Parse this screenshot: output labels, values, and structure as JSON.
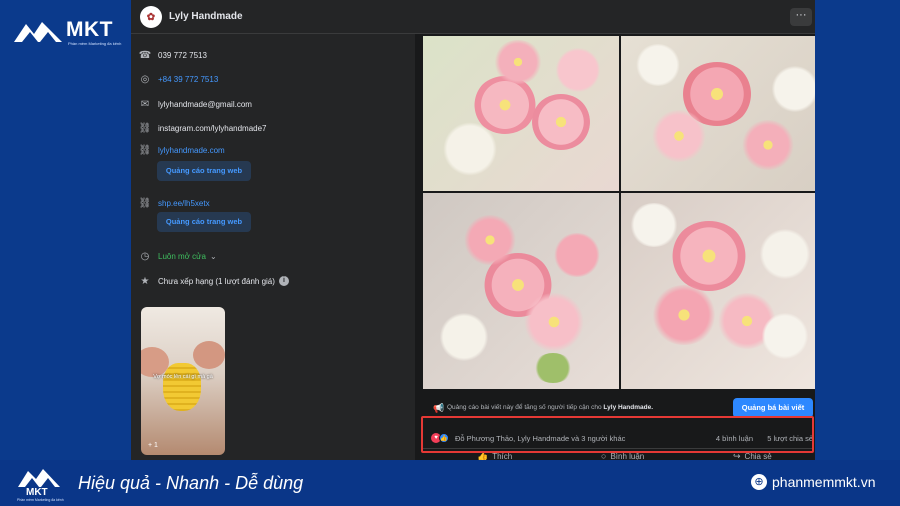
{
  "branding": {
    "logo_text": "MKT",
    "logo_tagline": "Phần mềm Marketing đa kênh",
    "slogan": "Hiệu quả - Nhanh  - Dễ dùng",
    "website": "phanmemmkt.vn",
    "bg_color": "#0b3a8c"
  },
  "page": {
    "name": "Lyly Handmade",
    "more_label": "···"
  },
  "intro": {
    "phone": "039 772 7513",
    "whatsapp": "+84 39 772 7513",
    "email": "lylyhandmade@gmail.com",
    "instagram": "instagram.com/lylyhandmade7",
    "website1": "lylyhandmade.com",
    "ad_button_1": "Quảng cáo trang web",
    "website2": "shp.ee/lh5xetx",
    "ad_button_2": "Quảng cáo trang web",
    "hours": "Luôn mở cửa",
    "rating": "Chưa xếp hạng (1 lượt đánh giá)"
  },
  "thumbnail": {
    "caption": "Vợ móc lên cái gì mà gà",
    "count": "+ 1"
  },
  "post": {
    "promo_text_prefix": "Quảng cáo bài viết này để tăng số người tiếp cận cho",
    "promo_page": "Lyly Handmade.",
    "boost_button": "Quảng bá bài viết",
    "reaction_names": "Đỗ Phương Thảo, Lyly Handmade và 3 người khác",
    "comments": "4 bình luận",
    "shares": "5 lượt chia sẻ",
    "like_action": "Thích",
    "comment_action": "Bình luận",
    "share_action": "Chia sẻ"
  },
  "colors": {
    "highlight": "#e53935",
    "accent": "#2d88ff"
  }
}
